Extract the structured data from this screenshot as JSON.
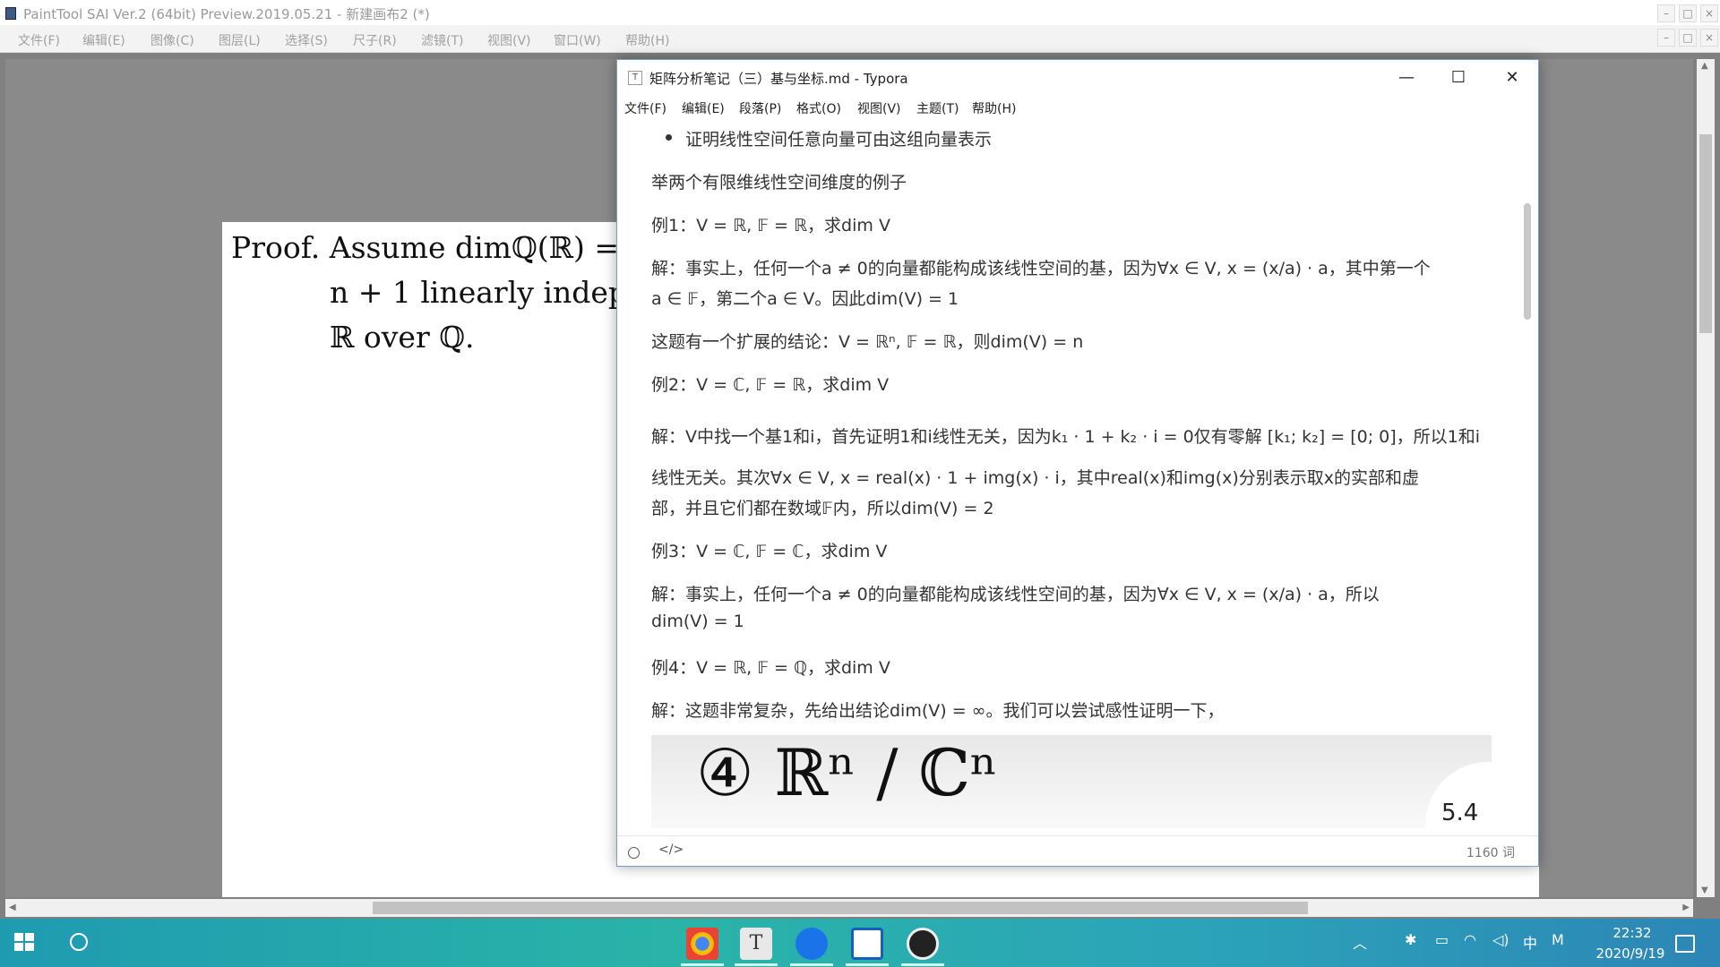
{
  "sai": {
    "title": "PaintTool SAI Ver.2 (64bit) Preview.2019.05.21 - 新建画布2 (*)",
    "menu": [
      "文件(F)",
      "编辑(E)",
      "图像(C)",
      "图层(L)",
      "选择(S)",
      "尺子(R)",
      "滤镜(T)",
      "视图(V)",
      "窗口(W)",
      "帮助(H)"
    ],
    "canvas_text": {
      "line1": "Proof.  Assume dimℚ(ℝ) =",
      "line2": "n + 1 linearly indepe",
      "line3": "ℝ over ℚ."
    }
  },
  "typora": {
    "title": "矩阵分析笔记（三）基与坐标.md - Typora",
    "menu": [
      "文件(F)",
      "编辑(E)",
      "段落(P)",
      "格式(O)",
      "视图(V)",
      "主题(T)",
      "帮助(H)"
    ],
    "lines": [
      "证明线性空间任意向量可由这组向量表示",
      "举两个有限维线性空间维度的例子",
      "例1：V = ℝ, 𝔽 = ℝ，求dim V",
      "解：事实上，任何一个a ≠ 0的向量都能构成该线性空间的基，因为∀x ∈ V, x = (x/a) · a，其中第一个",
      "a ∈ 𝔽，第二个a ∈ V。因此dim(V) = 1",
      "这题有一个扩展的结论：V = ℝⁿ, 𝔽 = ℝ，则dim(V) = n",
      "例2：V = ℂ, 𝔽 = ℝ，求dim V",
      "解：V中找一个基1和i，首先证明1和i线性无关，因为k₁ · 1 + k₂ · i = 0仅有零解 [k₁; k₂] = [0; 0]，所以1和i",
      "线性无关。其次∀x ∈ V, x = real(x) · 1 + img(x) · i，其中real(x)和img(x)分别表示取x的实部和虚",
      "部，并且它们都在数域𝔽内，所以dim(V) = 2",
      "例3：V = ℂ, 𝔽 = ℂ，求dim V",
      "解：事实上，任何一个a ≠ 0的向量都能构成该线性空间的基，因为∀x ∈ V, x = (x/a) · a，所以",
      "dim(V) = 1",
      "例4：V = ℝ, 𝔽 = ℚ，求dim V",
      "解：这题非常复杂，先给出结论dim(V) = ∞。我们可以尝试感性证明一下，"
    ],
    "image_text": "④  ℝⁿ / ℂⁿ",
    "image_badge": "5.4",
    "word_count": "1160 词"
  },
  "taskbar": {
    "time": "22:32",
    "date": "2020/9/19",
    "ime": "中",
    "ime_mode": "M"
  }
}
